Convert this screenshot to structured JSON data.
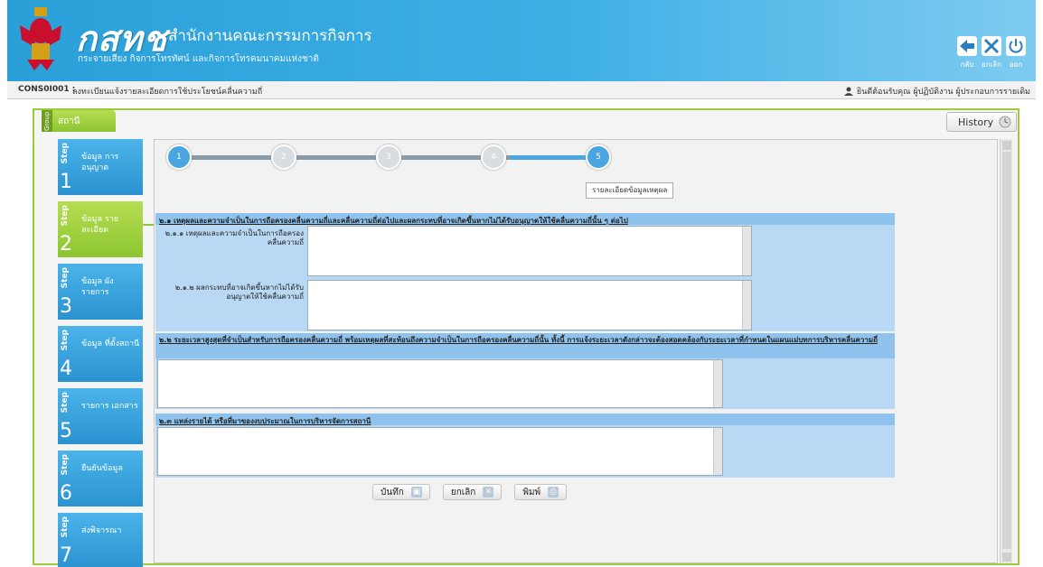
{
  "header": {
    "brand": "กสทช",
    "org": "สำนักงานคณะกรรมการกิจการ",
    "subtitle": "กระจายเสียง กิจการโทรทัศน์ และกิจการโทรคมนาคมแห่งชาติ",
    "actions": [
      {
        "label": "กลับ",
        "icon": "back-arrow-icon",
        "color": "#2a7fc0"
      },
      {
        "label": "ยกเลิก",
        "icon": "close-icon",
        "color": "#2a7fc0"
      },
      {
        "label": "ออก",
        "icon": "power-icon",
        "color": "#2a7fc0"
      }
    ]
  },
  "infobar": {
    "code": "CONS0I001 :",
    "title": "ลงทะเบียนแจ้งรายละเอียดการใช้ประโยชน์คลื่นความถี่",
    "welcome": "ยินดีต้อนรับคุณ ผู้ปฏิบัติงาน ผู้ประกอบการรายเดิม"
  },
  "group_tab": {
    "vertical": "Group",
    "label": "สถานี"
  },
  "history": {
    "label": "History"
  },
  "steps": [
    {
      "word": "Step",
      "num": "1",
      "label": "ข้อมูล การอนุญาต",
      "active": false
    },
    {
      "word": "Step",
      "num": "2",
      "label": "ข้อมูล รายละเอียด",
      "active": true
    },
    {
      "word": "Step",
      "num": "3",
      "label": "ข้อมูล ผังรายการ",
      "active": false
    },
    {
      "word": "Step",
      "num": "4",
      "label": "ข้อมูล ที่ตั้งสถานี",
      "active": false
    },
    {
      "word": "Step",
      "num": "5",
      "label": "รายการ เอกสาร",
      "active": false
    },
    {
      "word": "Step",
      "num": "6",
      "label": "ยืนยันข้อมูล",
      "active": false
    },
    {
      "word": "Step",
      "num": "7",
      "label": "ส่งพิจารณา",
      "active": false
    }
  ],
  "progress": {
    "dots": [
      "1",
      "2",
      "3",
      "4",
      "5"
    ],
    "current": 5,
    "tooltip": "รายละเอียดข้อมูลเหตุผล"
  },
  "sections": {
    "s21": "๒.๑ เหตุผลและความจำเป็นในการถือครองคลื่นความถี่และคลื่นความถี่ต่อไปและผลกระทบที่อาจเกิดขึ้นหากไม่ได้รับอนุญาตให้ใช้คลื่นความถี่นั้น ๆ ต่อไป",
    "s211": "๒.๑.๑ เหตุผลและความจำเป็นในการถือครองคลื่นความถี่",
    "s212": "๒.๑.๒ ผลกระทบที่อาจเกิดขึ้นหากไม่ได้รับอนุญาตให้ใช้คลื่นความถี่",
    "s22": "๒.๒ ระยะเวลาสูงสุดที่จำเป็นสำหรับการถือครองคลื่นความถี่ พร้อมเหตุผลที่สะท้อนถึงความจำเป็นในการถือครองคลื่นความถี่นั้น ทั้งนี้ การแจ้งระยะเวลาดังกล่าวจะต้องสอดคล้องกับระยะเวลาที่กำหนดในแผนแม่บทการบริหารคลื่นความถี่",
    "s23": "๒.๓ แหล่งรายได้ หรือที่มาของงบประมาณในการบริหารจัดการสถานี"
  },
  "buttons": {
    "save": "บันทึก",
    "cancel": "ยกเลิก",
    "print": "พิมพ์"
  }
}
